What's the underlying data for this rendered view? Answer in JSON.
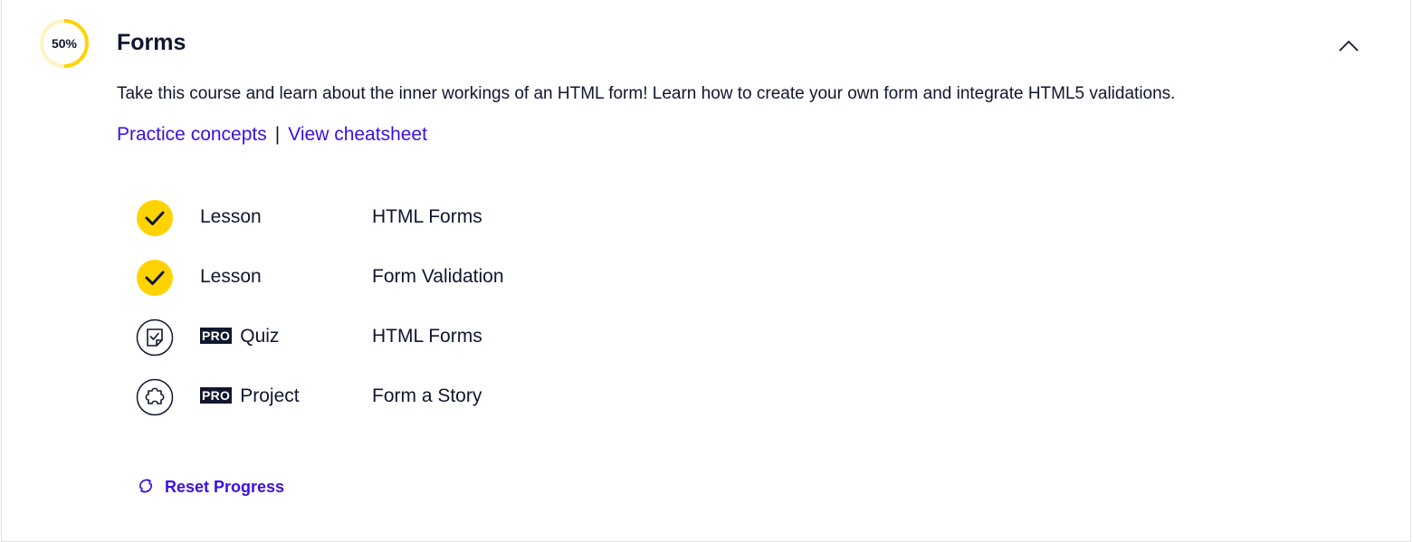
{
  "module": {
    "progress_label": "50%",
    "progress_fraction": 0.5,
    "title": "Forms",
    "description": "Take this course and learn about the inner workings of an HTML form! Learn how to create your own form and integrate HTML5 validations.",
    "practice_link": "Practice concepts",
    "separator": "|",
    "cheatsheet_link": "View cheatsheet",
    "collapse_icon": "chevron-up-icon"
  },
  "items": [
    {
      "pro": "",
      "type": "Lesson",
      "name": "HTML Forms",
      "icon": "completed-check-icon",
      "completed": true
    },
    {
      "pro": "",
      "type": "Lesson",
      "name": "Form Validation",
      "icon": "completed-check-icon",
      "completed": true
    },
    {
      "pro": "PRO",
      "type": "Quiz",
      "name": "HTML Forms",
      "icon": "quiz-icon",
      "completed": false
    },
    {
      "pro": "PRO",
      "type": "Project",
      "name": "Form a Story",
      "icon": "project-puzzle-icon",
      "completed": false
    }
  ],
  "reset": {
    "label": "Reset Progress",
    "icon": "refresh-icon"
  },
  "colors": {
    "accent": "#3a10e5",
    "progress": "#ffd300",
    "text": "#10162f"
  }
}
